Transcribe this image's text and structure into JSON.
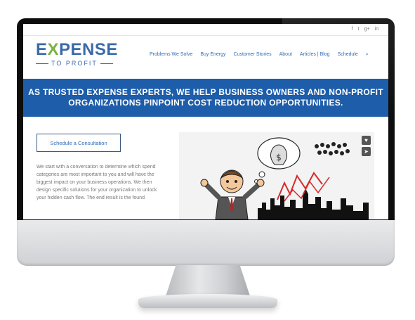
{
  "site": {
    "logo": {
      "main_left": "E",
      "main_x": "X",
      "main_right": "PENSE",
      "sub": "TO PROFIT"
    },
    "social": [
      "f",
      "t",
      "g+",
      "in"
    ],
    "nav": [
      "Problems We Solve",
      "Buy Energy",
      "Customer Stories",
      "About",
      "Articles | Blog",
      "Schedule",
      "⌕"
    ],
    "banner": {
      "line1": "AS TRUSTED EXPENSE EXPERTS, WE HELP BUSINESS OWNERS AND NON-PROFIT",
      "line2": "ORGANIZATIONS PINPOINT COST REDUCTION OPPORTUNITIES."
    },
    "cta_label": "Schedule a Consultation",
    "body": "We start with a conversation to determine which spend categories are most important to you and will have the biggest impact on your business operations. We then design specific solutions for your organization to unlock your hidden cash flow. The end result is the found",
    "art_buttons": [
      "♥",
      "➤"
    ]
  },
  "colors": {
    "brand_blue": "#1d5daa",
    "logo_green": "#7bb242",
    "link_blue": "#2f6bb5"
  }
}
